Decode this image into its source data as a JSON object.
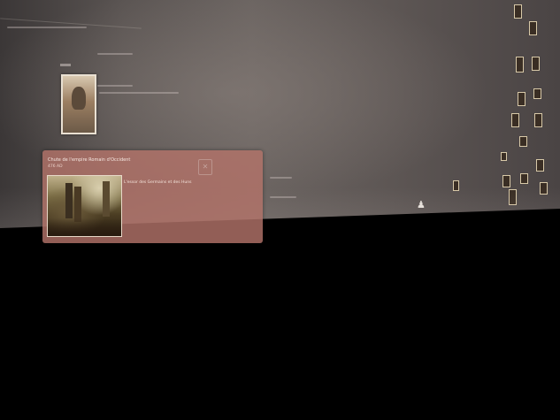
{
  "card": {
    "title": "Chute de l'empire Romain d'Occident",
    "date": "476 AD",
    "caption": "L'essor des Germains et des Huns",
    "close_icon": "close-icon"
  },
  "background": {
    "person_icon": "person-icon"
  }
}
